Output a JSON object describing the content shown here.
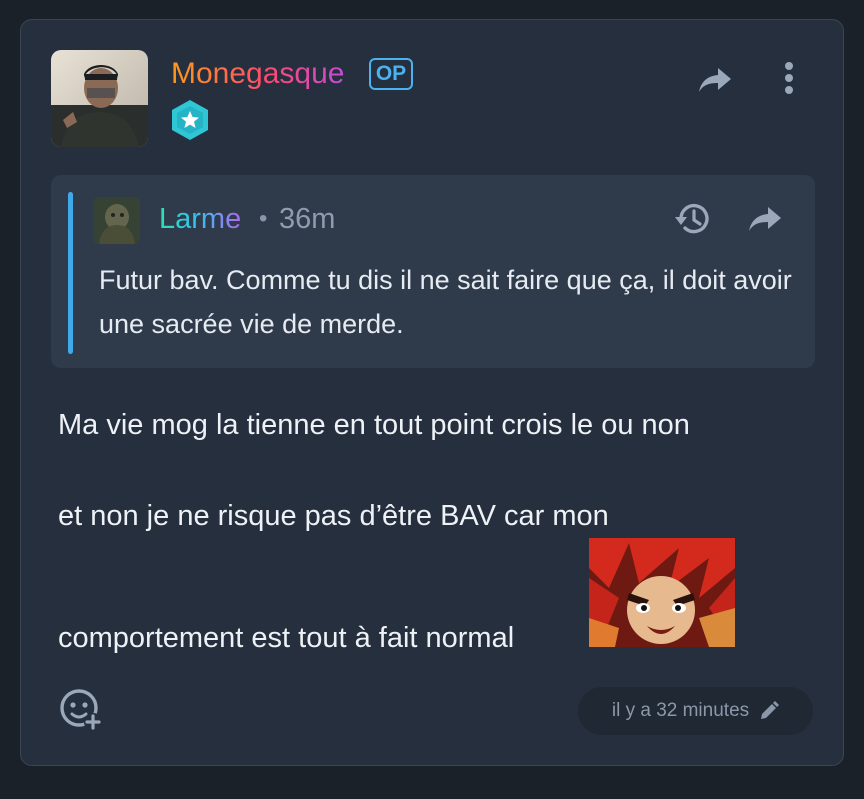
{
  "post": {
    "author": {
      "name": "Monegasque",
      "op_label": "OP",
      "avatar_icon": "user-selfie-avatar",
      "rank_icon": "star-hexagon-badge-icon",
      "name_gradient": [
        "#ff9a1a",
        "#ff4a6e",
        "#c24bd6"
      ]
    },
    "actions": {
      "share_icon": "share-arrow-icon",
      "more_icon": "vertical-dots-icon"
    },
    "quote": {
      "author": "Larme",
      "separator": "•",
      "time": "36m",
      "text": "Futur bav. Comme tu dis il ne sait faire que ça, il doit avoir une sacrée vie de merde.",
      "bar_color": "#40a9ec",
      "history_icon": "history-icon",
      "share_icon": "share-arrow-icon"
    },
    "body": {
      "line1": "Ma vie mog la tienne en tout point crois le ou non",
      "line2": "et non je ne risque pas d’être BAV car mon",
      "line3": "comportement est tout à fait normal",
      "sticker_icon": "angry-anime-sticker"
    },
    "footer": {
      "reaction_icon": "add-reaction-icon",
      "timestamp": "il y a 32 minutes",
      "edit_icon": "pencil-icon"
    }
  }
}
